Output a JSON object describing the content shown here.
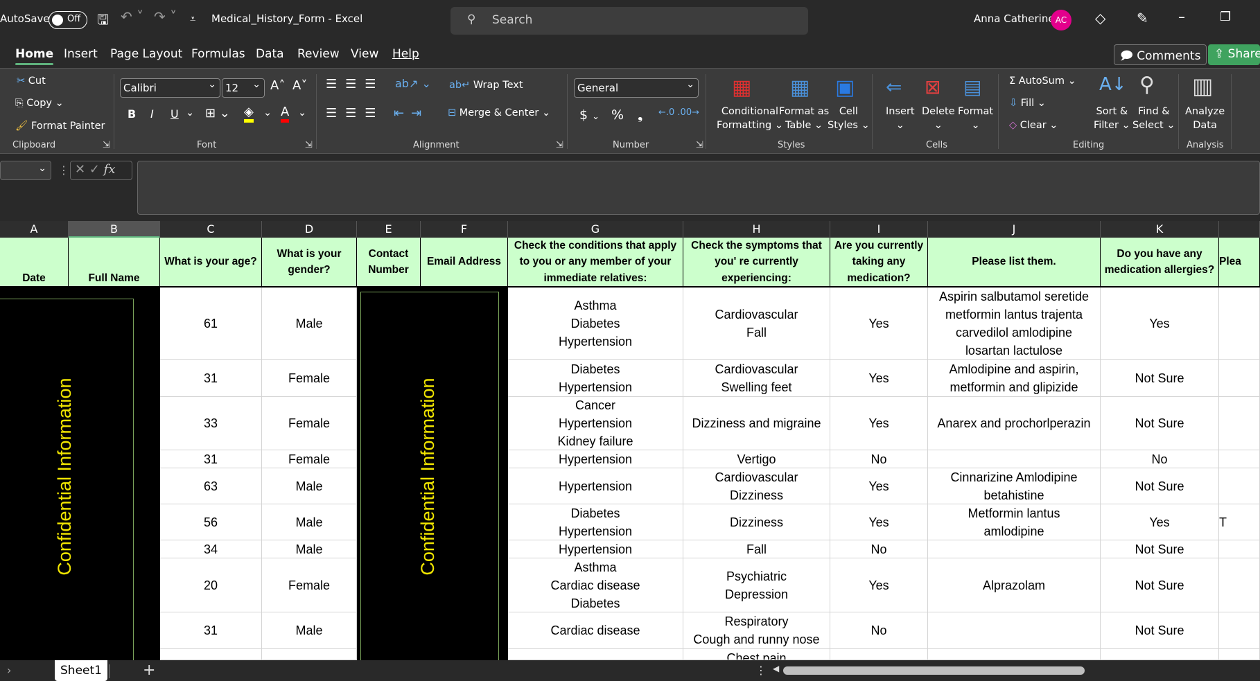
{
  "titlebar": {
    "autosave_label": "AutoSave",
    "autosave_state": "Off",
    "doc_title": "Medical_History_Form  -  Excel",
    "search_placeholder": "Search",
    "user_name": "Anna Catherine",
    "user_initials": "AC",
    "avatar_color": "#e3008c"
  },
  "tabs": [
    "Home",
    "Insert",
    "Page Layout",
    "Formulas",
    "Data",
    "Review",
    "View",
    "Help"
  ],
  "active_tab": "Home",
  "actions": {
    "comments": "Comments",
    "share": "Share"
  },
  "ribbon": {
    "clipboard": {
      "cut": "Cut",
      "copy": "Copy",
      "format_painter": "Format Painter",
      "label": "Clipboard"
    },
    "font": {
      "name": "Calibri",
      "size": "12",
      "bold": "B",
      "italic": "I",
      "underline": "U",
      "label": "Font",
      "highlight_color": "#ffff00",
      "font_color": "#ff0000"
    },
    "alignment": {
      "wrap_text": "Wrap Text",
      "merge_center": "Merge & Center",
      "label": "Alignment"
    },
    "number": {
      "format": "General",
      "currency": "$",
      "percent": "%",
      "comma": "❟",
      "label": "Number"
    },
    "styles": {
      "conditional": "Conditional\nFormatting ⌄",
      "format_table": "Format as\nTable ⌄",
      "cell_styles": "Cell\nStyles ⌄",
      "label": "Styles"
    },
    "cells": {
      "insert": "Insert\n⌄",
      "delete": "Delete\n⌄",
      "format": "Format\n⌄",
      "label": "Cells"
    },
    "editing": {
      "autosum": "AutoSum",
      "fill": "Fill",
      "clear": "Clear",
      "sort_filter": "Sort &\nFilter ⌄",
      "find_select": "Find &\nSelect ⌄",
      "label": "Editing"
    },
    "analysis": {
      "analyze": "Analyze\nData",
      "label": "Analysis"
    }
  },
  "formula_bar": {
    "fx": "fx",
    "value": ""
  },
  "columns": [
    "A",
    "B",
    "C",
    "D",
    "E",
    "F",
    "G",
    "H",
    "I",
    "J",
    "K",
    ""
  ],
  "selected_column": "B",
  "headers": [
    "Date",
    "Full Name",
    "What is your age?",
    "What is your gender?",
    "Contact Number",
    "Email Address",
    "Check the conditions that apply to you or any member of your immediate relatives:",
    "Check the symptoms that you' re currently experiencing:",
    "Are you currently taking any medication?",
    "Please list them.",
    "Do you have any medication allergies?",
    "Plea"
  ],
  "redacted_label": "Confidential Information",
  "rows": [
    {
      "age": "61",
      "gender": "Male",
      "conditions": "Asthma\nDiabetes\nHypertension",
      "symptoms": "Cardiovascular\nFall",
      "medication": "Yes",
      "list": "Aspirin salbutamol seretide\nmetformin lantus trajenta\ncarvedilol amlodipine\nlosartan lactulose",
      "allergies": "Yes",
      "extra": ""
    },
    {
      "age": "31",
      "gender": "Female",
      "conditions": "Diabetes\nHypertension",
      "symptoms": "Cardiovascular\nSwelling feet",
      "medication": "Yes",
      "list": "Amlodipine and aspirin,\nmetformin and glipizide",
      "allergies": "Not Sure",
      "extra": ""
    },
    {
      "age": "33",
      "gender": "Female",
      "conditions": "Cancer\nHypertension\nKidney failure",
      "symptoms": "Dizziness and migraine",
      "medication": "Yes",
      "list": "Anarex and prochorlperazin",
      "allergies": "Not Sure",
      "extra": ""
    },
    {
      "age": "31",
      "gender": "Female",
      "conditions": "Hypertension",
      "symptoms": "Vertigo",
      "medication": "No",
      "list": "",
      "allergies": "No",
      "extra": ""
    },
    {
      "age": "63",
      "gender": "Male",
      "conditions": "Hypertension",
      "symptoms": "Cardiovascular\nDizziness",
      "medication": "Yes",
      "list": "Cinnarizine Amlodipine\nbetahistine",
      "allergies": "Not Sure",
      "extra": ""
    },
    {
      "age": "56",
      "gender": "Male",
      "conditions": "Diabetes\nHypertension",
      "symptoms": "Dizziness",
      "medication": "Yes",
      "list": "Metformin lantus\namlodipine",
      "allergies": "Yes",
      "extra": "T"
    },
    {
      "age": "34",
      "gender": "Male",
      "conditions": "Hypertension",
      "symptoms": "Fall",
      "medication": "No",
      "list": "",
      "allergies": "Not Sure",
      "extra": ""
    },
    {
      "age": "20",
      "gender": "Female",
      "conditions": "Asthma\nCardiac disease\nDiabetes",
      "symptoms": "Psychiatric\nDepression",
      "medication": "Yes",
      "list": "Alprazolam",
      "allergies": "Not Sure",
      "extra": ""
    },
    {
      "age": "31",
      "gender": "Male",
      "conditions": "Cardiac disease",
      "symptoms": "Respiratory\nCough and runny nose",
      "medication": "No",
      "list": "",
      "allergies": "Not Sure",
      "extra": ""
    },
    {
      "age": "",
      "gender": "",
      "conditions": "",
      "symptoms": "Chest pain",
      "medication": "",
      "list": "",
      "allergies": "",
      "extra": ""
    }
  ],
  "sheets": [
    "Sheet1"
  ],
  "add_sheet": "+"
}
